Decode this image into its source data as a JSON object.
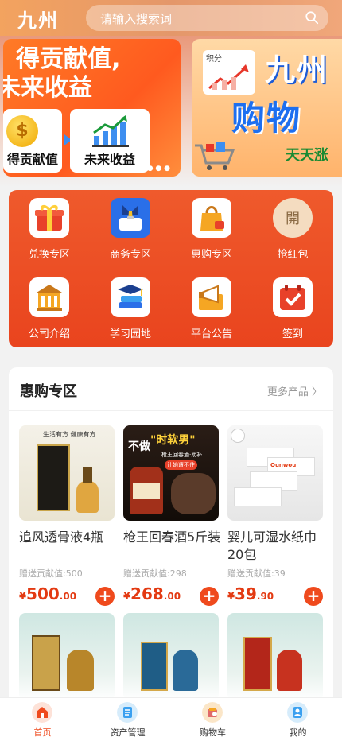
{
  "header": {
    "logo": "九州",
    "search_placeholder": "请输入搜索词"
  },
  "banner": {
    "slide1": {
      "title_line1": "得贡献值,",
      "title_line2": "未来收益",
      "card1_label": "得贡献值",
      "card2_label": "未来收益",
      "coin_symbol": "$",
      "dots": "● ●  ● ●"
    },
    "slide2": {
      "panel_label": "积分",
      "big1": "九州",
      "big2": "购物",
      "small": "天天涨"
    }
  },
  "menu": {
    "items": [
      {
        "label": "兑换专区",
        "icon": "gift-icon"
      },
      {
        "label": "商务专区",
        "icon": "briefcase-icon"
      },
      {
        "label": "惠购专区",
        "icon": "shopping-bag-icon"
      },
      {
        "label": "抢红包",
        "icon": "red-envelope-icon",
        "glyph": "開"
      },
      {
        "label": "公司介绍",
        "icon": "building-icon"
      },
      {
        "label": "学习园地",
        "icon": "books-icon"
      },
      {
        "label": "平台公告",
        "icon": "megaphone-icon"
      },
      {
        "label": "签到",
        "icon": "calendar-check-icon"
      }
    ]
  },
  "section": {
    "title": "惠购专区",
    "more": "更多产品 〉",
    "products": [
      {
        "name": "追风透骨液4瓶",
        "gift": "赠送贡献值:500",
        "price_currency": "¥",
        "price_int": "500",
        "price_dec": ".00"
      },
      {
        "name": "枪王回春酒5斤装",
        "gift": "赠送贡献值:298",
        "price_currency": "¥",
        "price_int": "268",
        "price_dec": ".00"
      },
      {
        "name": "婴儿可湿水纸巾20包",
        "gift": "赠送贡献值:39",
        "price_currency": "¥",
        "price_int": "39",
        "price_dec": ".90"
      }
    ],
    "product_images": {
      "p1_top": "生活有方 健康有方",
      "p2_line1": "不做",
      "p2_line2": "\"时软男\"",
      "p2_line3": "枪王回春酒·助补",
      "p2_line4": "让她遭不住",
      "p3_brand": "Qunwou"
    }
  },
  "tabbar": {
    "tabs": [
      {
        "label": "首页",
        "active": true
      },
      {
        "label": "资产管理",
        "active": false
      },
      {
        "label": "购物车",
        "active": false
      },
      {
        "label": "我的",
        "active": false
      }
    ]
  },
  "colors": {
    "accent": "#ef4a1d",
    "price": "#e33a12",
    "menu_bg": "#ec4e24"
  }
}
